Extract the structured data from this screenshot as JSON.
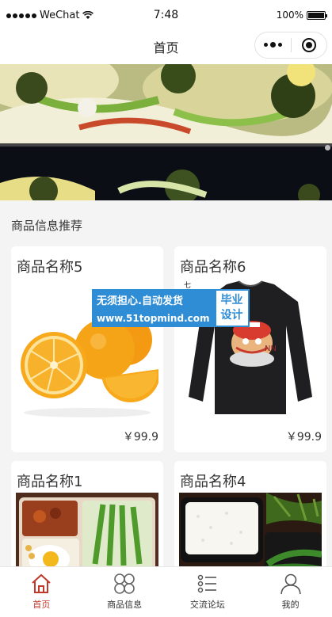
{
  "status_bar": {
    "signal_dots": 5,
    "carrier": "WeChat",
    "time": "7:48",
    "battery": "100%"
  },
  "navbar": {
    "title": "首页"
  },
  "section": {
    "title": "商品信息推荐"
  },
  "products": [
    {
      "name": "商品名称5",
      "price": "￥99.9",
      "image": "oranges"
    },
    {
      "name": "商品名称6",
      "price": "￥99.9",
      "image": "black-tshirt"
    },
    {
      "name": "商品名称1",
      "price": "",
      "image": "bento-box"
    },
    {
      "name": "商品名称4",
      "price": "",
      "image": "rice-box"
    }
  ],
  "watermark": {
    "line1": "无须担心.自动发货",
    "line2": "www.51topmind.com",
    "right_line1": "毕业",
    "right_line2": "设计"
  },
  "tabbar": [
    {
      "label": "首页",
      "icon": "home-icon",
      "active": true
    },
    {
      "label": "商品信息",
      "icon": "grid-icon",
      "active": false
    },
    {
      "label": "交流论坛",
      "icon": "list-icon",
      "active": false
    },
    {
      "label": "我的",
      "icon": "user-icon",
      "active": false
    }
  ],
  "colors": {
    "accent": "#c0392b",
    "watermark_blue": "#2f8dd6",
    "background": "#f4f4f4"
  }
}
